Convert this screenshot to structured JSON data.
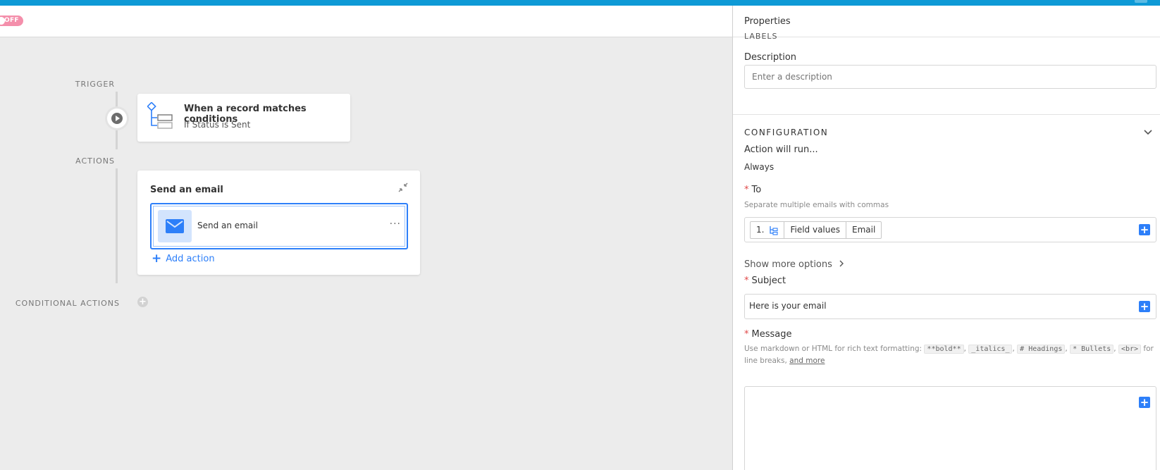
{
  "header": {
    "toggle_label": "OFF"
  },
  "workflow": {
    "trigger_label": "TRIGGER",
    "actions_label": "ACTIONS",
    "conditional_actions_label": "CONDITIONAL ACTIONS",
    "trigger_card": {
      "title": "When a record matches conditions",
      "subtitle": "If Status is Sent"
    },
    "action_card": {
      "title": "Send an email",
      "step_label": "Send an email",
      "more_label": "···",
      "add_action_label": "Add action"
    }
  },
  "panel": {
    "title": "Properties",
    "labels_section": "LABELS",
    "description_label": "Description",
    "description_placeholder": "Enter a description",
    "configuration_title": "CONFIGURATION",
    "action_run_label": "Action will run...",
    "action_run_value": "Always",
    "to": {
      "label": "To",
      "required_mark": "*",
      "hint": "Separate multiple emails with commas",
      "pills": [
        "1.",
        "Field values",
        "Email"
      ]
    },
    "show_more_label": "Show more options",
    "subject": {
      "label": "Subject",
      "required_mark": "*",
      "value": "Here is your email"
    },
    "message": {
      "label": "Message",
      "required_mark": "*",
      "hint_prefix": "Use markdown or HTML for rich text formatting:",
      "codes": [
        "**bold**",
        "_italics_",
        "# Headings",
        "* Bullets",
        "<br>"
      ],
      "hint_suffix": "for line breaks,",
      "hint_link": "and more"
    }
  },
  "colors": {
    "accent": "#2d7ff9",
    "topbar": "#0e9ad6",
    "off_toggle": "#f48fab",
    "required": "#e04848"
  }
}
